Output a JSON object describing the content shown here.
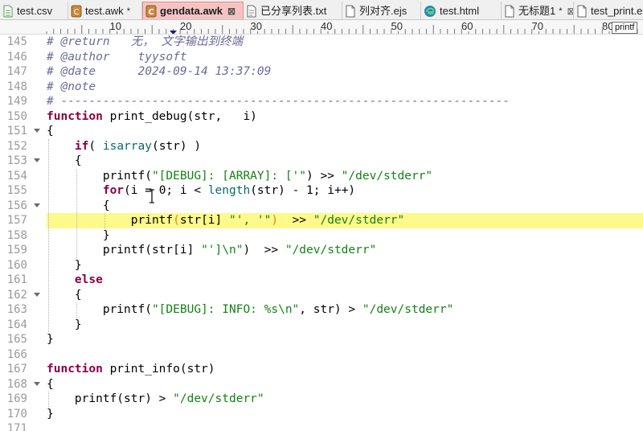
{
  "tabs": [
    {
      "label": "test.csv",
      "icon": "csv-file-icon",
      "modified": false,
      "active": false,
      "closable": false
    },
    {
      "label": "test.awk",
      "icon": "awk-file-icon",
      "modified": true,
      "modified_mark": "*",
      "active": false,
      "closable": false
    },
    {
      "label": "gendata.awk",
      "icon": "awk-file-icon",
      "modified": false,
      "active": true,
      "closable": true,
      "close_glyph": "⊠"
    },
    {
      "label": "已分享列表.txt",
      "icon": "text-file-icon",
      "modified": false,
      "active": false,
      "closable": false
    },
    {
      "label": "列对齐.ejs",
      "icon": "document-icon",
      "modified": false,
      "active": false,
      "closable": false
    },
    {
      "label": "test.html",
      "icon": "edge-browser-icon",
      "modified": false,
      "active": false,
      "closable": false
    },
    {
      "label": "无标题1",
      "icon": "document-icon",
      "modified": true,
      "modified_mark": "*",
      "active": false,
      "closable": true,
      "close_glyph": "⊠"
    },
    {
      "label": "test_print.e",
      "icon": "document-icon",
      "modified": false,
      "active": false,
      "closable": false
    }
  ],
  "ruler": {
    "labels": [
      "10",
      "20",
      "30",
      "40",
      "50",
      "60",
      "70",
      "80"
    ],
    "tooltip": "printf"
  },
  "editor": {
    "current_line": 157,
    "lines": [
      {
        "n": "145",
        "fold": false,
        "tokens": [
          [
            "comment",
            "# @return   无， 文字输出到终端"
          ]
        ]
      },
      {
        "n": "146",
        "fold": false,
        "tokens": [
          [
            "comment",
            "# @author    tyysoft"
          ]
        ]
      },
      {
        "n": "147",
        "fold": false,
        "tokens": [
          [
            "comment",
            "# @date      2024-09-14 13:37:09"
          ]
        ]
      },
      {
        "n": "148",
        "fold": false,
        "tokens": [
          [
            "comment",
            "# @note"
          ]
        ]
      },
      {
        "n": "149",
        "fold": false,
        "tokens": [
          [
            "comment",
            "# ----------------------------------------------------------------"
          ]
        ]
      },
      {
        "n": "150",
        "fold": false,
        "tokens": [
          [
            "kw",
            "function"
          ],
          [
            "fn",
            " print_debug(str,   i)"
          ]
        ]
      },
      {
        "n": "151",
        "fold": true,
        "tokens": [
          [
            "fn",
            "{"
          ]
        ]
      },
      {
        "n": "152",
        "fold": false,
        "tokens": [
          [
            "fn",
            "    "
          ],
          [
            "kw",
            "if"
          ],
          [
            "fn",
            "( "
          ],
          [
            "builtin",
            "isarray"
          ],
          [
            "fn",
            "(str) )"
          ]
        ]
      },
      {
        "n": "153",
        "fold": true,
        "tokens": [
          [
            "fn",
            "    {"
          ]
        ]
      },
      {
        "n": "154",
        "fold": false,
        "tokens": [
          [
            "fn",
            "        printf("
          ],
          [
            "str",
            "\"[DEBUG]: [ARRAY]: ['\""
          ],
          [
            "fn",
            ") >> "
          ],
          [
            "str",
            "\"/dev/stderr\""
          ]
        ]
      },
      {
        "n": "155",
        "fold": false,
        "tokens": [
          [
            "fn",
            "        "
          ],
          [
            "kw",
            "for"
          ],
          [
            "fn",
            "(i = 0; i < "
          ],
          [
            "builtin",
            "length"
          ],
          [
            "fn",
            "(str) - 1; i++)"
          ]
        ]
      },
      {
        "n": "156",
        "fold": true,
        "tokens": [
          [
            "fn",
            "        {"
          ]
        ]
      },
      {
        "n": "157",
        "fold": false,
        "tokens": [
          [
            "fn",
            "            printf"
          ],
          [
            "paren",
            "("
          ],
          [
            "fn",
            "str[i] "
          ],
          [
            "str",
            "\"', '\""
          ],
          [
            "paren",
            ")"
          ],
          [
            "fn",
            "  >> "
          ],
          [
            "str",
            "\"/dev/stderr\""
          ]
        ]
      },
      {
        "n": "158",
        "fold": false,
        "tokens": [
          [
            "fn",
            "        }"
          ]
        ]
      },
      {
        "n": "159",
        "fold": false,
        "tokens": [
          [
            "fn",
            "        printf(str[i] "
          ],
          [
            "str",
            "\"']\\n\""
          ],
          [
            "fn",
            ")  >> "
          ],
          [
            "str",
            "\"/dev/stderr\""
          ]
        ]
      },
      {
        "n": "160",
        "fold": false,
        "tokens": [
          [
            "fn",
            "    }"
          ]
        ]
      },
      {
        "n": "161",
        "fold": false,
        "tokens": [
          [
            "fn",
            "    "
          ],
          [
            "kw",
            "else"
          ]
        ]
      },
      {
        "n": "162",
        "fold": true,
        "tokens": [
          [
            "fn",
            "    {"
          ]
        ]
      },
      {
        "n": "163",
        "fold": false,
        "tokens": [
          [
            "fn",
            "        printf("
          ],
          [
            "str",
            "\"[DEBUG]: INFO: %s\\n\""
          ],
          [
            "fn",
            ", str) > "
          ],
          [
            "str",
            "\"/dev/stderr\""
          ]
        ]
      },
      {
        "n": "164",
        "fold": false,
        "tokens": [
          [
            "fn",
            "    }"
          ]
        ]
      },
      {
        "n": "165",
        "fold": false,
        "tokens": [
          [
            "fn",
            "}"
          ]
        ]
      },
      {
        "n": "166",
        "fold": false,
        "tokens": []
      },
      {
        "n": "167",
        "fold": false,
        "tokens": [
          [
            "kw",
            "function"
          ],
          [
            "fn",
            " print_info(str)"
          ]
        ]
      },
      {
        "n": "168",
        "fold": true,
        "tokens": [
          [
            "fn",
            "{"
          ]
        ]
      },
      {
        "n": "169",
        "fold": false,
        "tokens": [
          [
            "fn",
            "    printf(str) > "
          ],
          [
            "str",
            "\"/dev/stderr\""
          ]
        ]
      },
      {
        "n": "170",
        "fold": false,
        "tokens": [
          [
            "fn",
            "}"
          ]
        ]
      },
      {
        "n": "171",
        "fold": false,
        "tokens": []
      }
    ]
  },
  "colors": {
    "current_line_bg": "#fdf98a",
    "keyword": "#8b0045",
    "string": "#148214",
    "comment": "#6a6a9a",
    "builtin": "#0b6a6a",
    "active_tab_bg": "#f6c3c3"
  }
}
